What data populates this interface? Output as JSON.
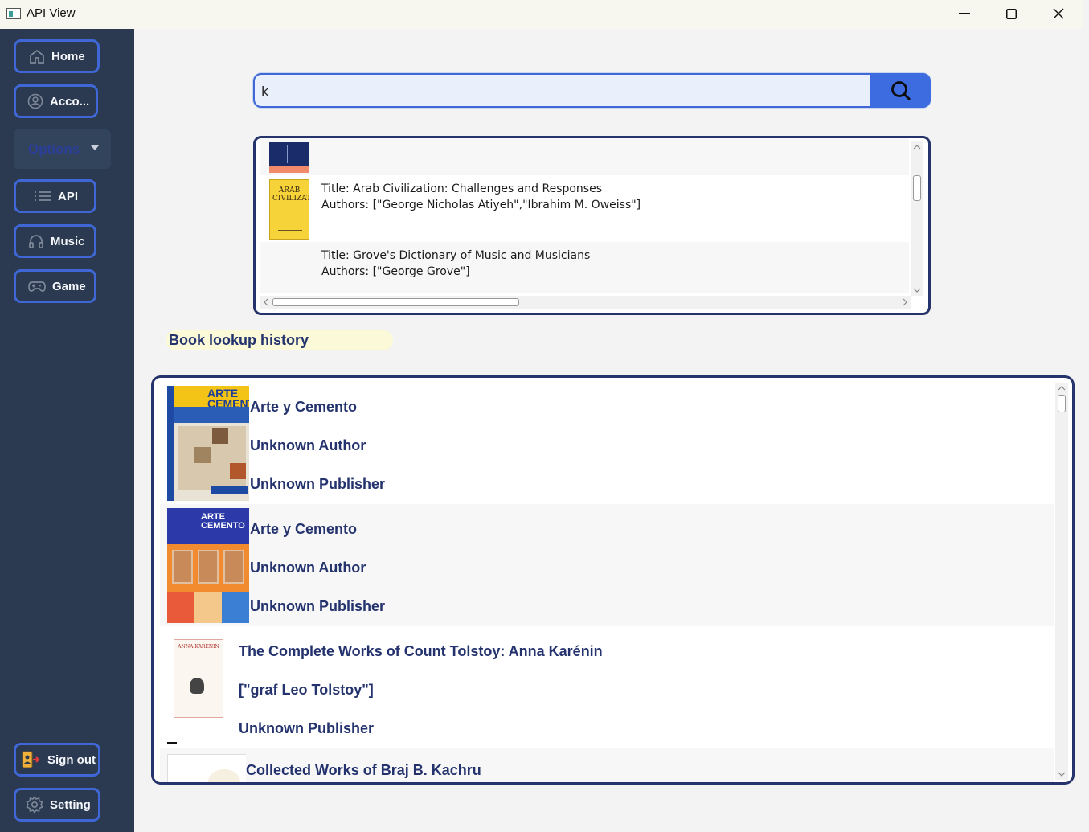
{
  "window": {
    "title": "API View",
    "minimize": "—",
    "maximize": "☐",
    "close": "✕"
  },
  "sidebar": {
    "home": "Home",
    "account": "Acco...",
    "options": "Options",
    "api": "API",
    "music": "Music",
    "game": "Game",
    "signout": "Sign out",
    "setting": "Setting"
  },
  "search": {
    "value": "k"
  },
  "results": [
    {
      "title": "",
      "authors": ""
    },
    {
      "title": "Title: Arab Civilization: Challenges and Responses",
      "authors": "Authors: [\"George Nicholas Atiyeh\",\"Ibrahim M. Oweiss\"]",
      "cover_text": "ARAB CIVILIZATION"
    },
    {
      "title": "Title: Grove's Dictionary of Music and Musicians",
      "authors": "Authors: [\"George Grove\"]"
    }
  ],
  "history_label": "Book lookup history",
  "history": [
    {
      "title": "Arte y Cemento",
      "author": "Unknown Author",
      "publisher": "Unknown Publisher",
      "cover_text": "ARTE CEMENTO"
    },
    {
      "title": "Arte y Cemento",
      "author": "Unknown Author",
      "publisher": "Unknown Publisher",
      "cover_text": "ARTE CEMENTO"
    },
    {
      "title": "The Complete Works of Count Tolstoy: Anna Karénin",
      "author": "[\"graf Leo Tolstoy\"]",
      "publisher": "Unknown Publisher",
      "cover_text": "ANNA KARÉNIN"
    },
    {
      "title": "Collected Works of Braj B. Kachru",
      "author": "",
      "publisher": ""
    }
  ],
  "colors": {
    "sidebar": "#2b3a50",
    "accent": "#3f68d6",
    "navy": "#24336e"
  }
}
